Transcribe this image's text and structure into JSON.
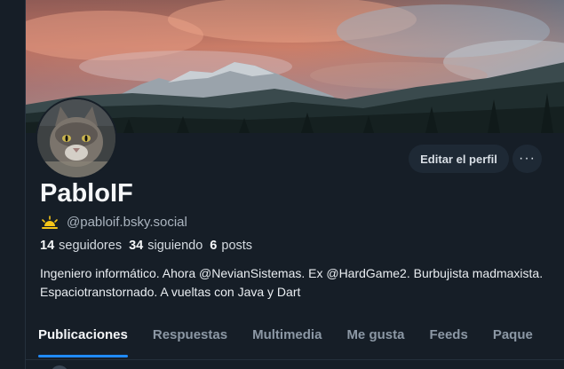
{
  "profile": {
    "display_name": "PabloIF",
    "handle": "@pabloif.bsky.social",
    "stats": {
      "followers_count": "14",
      "followers_label": "seguidores",
      "following_count": "34",
      "following_label": "siguiendo",
      "posts_count": "6",
      "posts_label": "posts"
    },
    "bio": "Ingeniero informático. Ahora @NevianSistemas. Ex @HardGame2. Burbujista madmaxista. Espaciotranstornado. A vueltas con Java y Dart"
  },
  "actions": {
    "edit_label": "Editar el perfil",
    "more_label": "···"
  },
  "tabs": [
    {
      "label": "Publicaciones",
      "active": true
    },
    {
      "label": "Respuestas",
      "active": false
    },
    {
      "label": "Multimedia",
      "active": false
    },
    {
      "label": "Me gusta",
      "active": false
    },
    {
      "label": "Feeds",
      "active": false
    },
    {
      "label": "Paque",
      "active": false
    }
  ],
  "icons": {
    "banner": "mountain-sunset-banner",
    "avatar": "cat-avatar",
    "badge": "sunrise-icon",
    "more": "more-horizontal-icon"
  },
  "colors": {
    "background": "#161e27",
    "accent": "#208bfe",
    "badge": "#f5c518"
  }
}
